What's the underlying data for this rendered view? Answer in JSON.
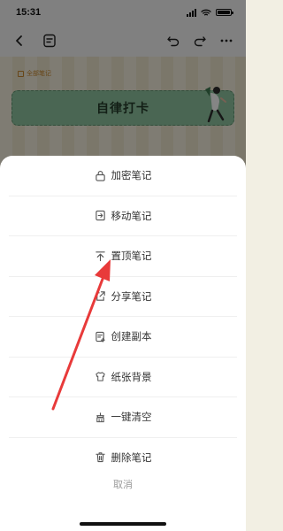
{
  "status_bar": {
    "time": "15:31",
    "icons": [
      "signal-icon",
      "wifi-icon",
      "battery-icon"
    ]
  },
  "toolbar": {
    "icons": [
      "back-icon",
      "note-list-icon",
      "undo-icon",
      "redo-icon",
      "more-icon"
    ]
  },
  "note": {
    "folder_label": "全部笔记",
    "banner_title": "自律打卡"
  },
  "menu": {
    "items": [
      {
        "label": "加密笔记",
        "icon": "lock-icon"
      },
      {
        "label": "移动笔记",
        "icon": "move-icon"
      },
      {
        "label": "置顶笔记",
        "icon": "pin-top-icon"
      },
      {
        "label": "分享笔记",
        "icon": "share-icon"
      },
      {
        "label": "创建副本",
        "icon": "copy-icon"
      },
      {
        "label": "纸张背景",
        "icon": "shirt-icon"
      },
      {
        "label": "一键清空",
        "icon": "clear-icon"
      },
      {
        "label": "删除笔记",
        "icon": "trash-icon"
      }
    ],
    "cancel_label": "取消"
  },
  "colors": {
    "accent": "#c7872e",
    "banner": "#8ec4a0",
    "annotation_arrow": "#e83a3a"
  }
}
